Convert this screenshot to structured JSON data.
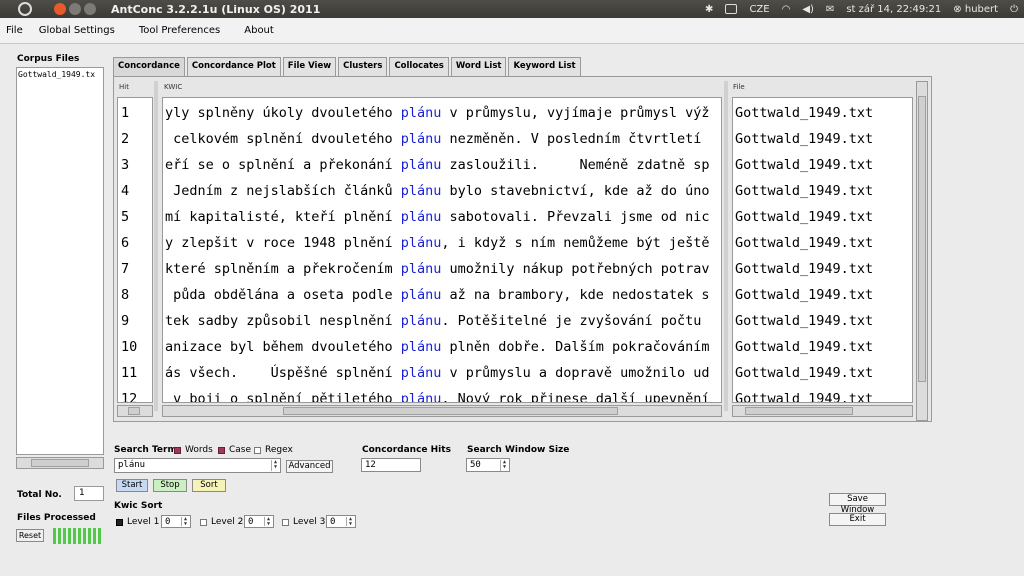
{
  "window": {
    "title": "AntConc 3.2.2.1u (Linux OS) 2011",
    "tray": {
      "keyboard": "CZE",
      "datetime": "st zář 14, 22:49:21",
      "user": "hubert"
    }
  },
  "menu": [
    "File",
    "Global Settings",
    "Tool Preferences",
    "About"
  ],
  "corpus": {
    "label": "Corpus Files",
    "files": [
      "Gottwald_1949.tx"
    ]
  },
  "tabs": [
    "Concordance",
    "Concordance Plot",
    "File View",
    "Clusters",
    "Collocates",
    "Word List",
    "Keyword List"
  ],
  "results": {
    "headers": {
      "hit": "Hit",
      "kwic": "KWIC",
      "file": "File"
    },
    "rows": [
      {
        "hit": "1",
        "left": "yly splněny úkoly dvouletého ",
        "kw": "plánu",
        "right": " v průmyslu, vyjímaje průmysl výž",
        "file": "Gottwald_1949.txt"
      },
      {
        "hit": "2",
        "left": " celkovém splnění dvouletého ",
        "kw": "plánu",
        "right": " nezměněn. V posledním čtvrtletí",
        "file": "Gottwald_1949.txt"
      },
      {
        "hit": "3",
        "left": "eří se o splnění a překonání ",
        "kw": "plánu",
        "right": " zasloužili.     Neméně zdatně sp",
        "file": "Gottwald_1949.txt"
      },
      {
        "hit": "4",
        "left": " Jedním z nejslabších článků ",
        "kw": "plánu",
        "right": " bylo stavebnictví, kde až do úno",
        "file": "Gottwald_1949.txt"
      },
      {
        "hit": "5",
        "left": "mí kapitalisté, kteří plnění ",
        "kw": "plánu",
        "right": " sabotovali. Převzali jsme od nic",
        "file": "Gottwald_1949.txt"
      },
      {
        "hit": "6",
        "left": "y zlepšit v roce 1948 plnění ",
        "kw": "plánu",
        "right": ", i když s ním nemůžeme být ještě",
        "file": "Gottwald_1949.txt"
      },
      {
        "hit": "7",
        "left": "které splněním a překročením ",
        "kw": "plánu",
        "right": " umožnily nákup potřebných potrav",
        "file": "Gottwald_1949.txt"
      },
      {
        "hit": "8",
        "left": " půda obdělána a oseta podle ",
        "kw": "plánu",
        "right": " až na brambory, kde nedostatek s",
        "file": "Gottwald_1949.txt"
      },
      {
        "hit": "9",
        "left": "tek sadby způsobil nesplnění ",
        "kw": "plánu",
        "right": ". Potěšitelné je zvyšování počtu ",
        "file": "Gottwald_1949.txt"
      },
      {
        "hit": "10",
        "left": "anizace byl během dvouletého ",
        "kw": "plánu",
        "right": " plněn dobře. Dalším pokračováním",
        "file": "Gottwald_1949.txt"
      },
      {
        "hit": "11",
        "left": "ás všech.    Úspěšné splnění ",
        "kw": "plánu",
        "right": " v průmyslu a dopravě umožnilo ud",
        "file": "Gottwald_1949.txt"
      },
      {
        "hit": "12",
        "left": " v boji o splnění pětiletého ",
        "kw": "plánu",
        "right": ". Nový rok přinese další upevnění",
        "file": "Gottwald_1949.txt"
      }
    ]
  },
  "search": {
    "label": "Search Term",
    "words_label": "Words",
    "case_label": "Case",
    "regex_label": "Regex",
    "term": "plánu",
    "advanced_label": "Advanced",
    "start_label": "Start",
    "stop_label": "Stop",
    "sort_label": "Sort"
  },
  "hits": {
    "label": "Concordance Hits",
    "value": "12"
  },
  "window_size": {
    "label": "Search Window Size",
    "value": "50"
  },
  "kwic_sort": {
    "label": "Kwic Sort",
    "levels": [
      {
        "label": "Level 1",
        "value": "0"
      },
      {
        "label": "Level 2",
        "value": "0"
      },
      {
        "label": "Level 3",
        "value": "0"
      }
    ]
  },
  "stats": {
    "total_label": "Total No.",
    "total_value": "1",
    "processed_label": "Files Processed",
    "reset_label": "Reset"
  },
  "actions": {
    "save_window": "Save Window",
    "exit": "Exit"
  }
}
